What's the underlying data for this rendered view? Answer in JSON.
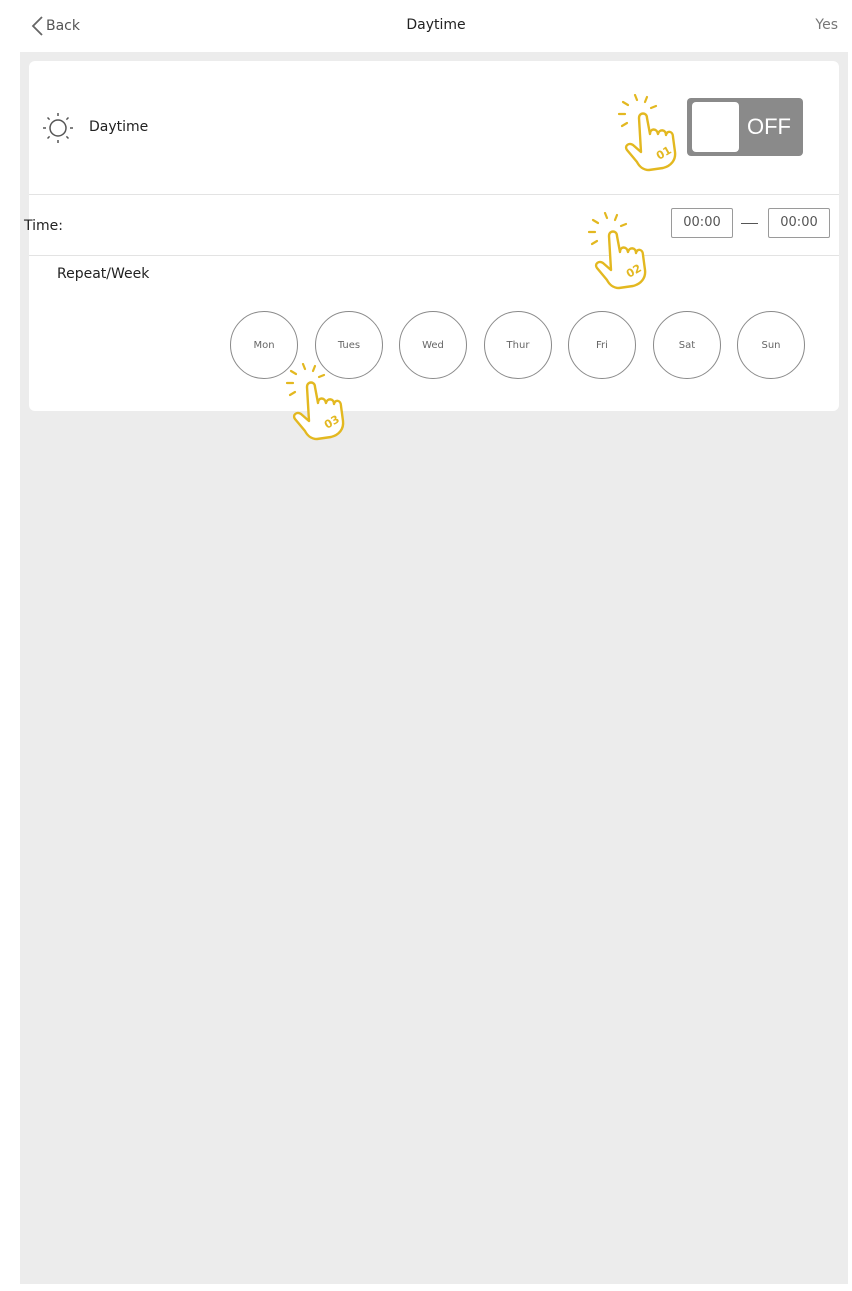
{
  "header": {
    "back_label": "Back",
    "title": "Daytime",
    "confirm_label": "Yes"
  },
  "daytime_row": {
    "label": "Daytime",
    "toggle_state": "OFF"
  },
  "time_row": {
    "label": "Time:",
    "start": "00:00",
    "end": "00:00"
  },
  "repeat": {
    "label": "Repeat/Week",
    "days": [
      "Mon",
      "Tues",
      "Wed",
      "Thur",
      "Fri",
      "Sat",
      "Sun"
    ]
  },
  "hints": [
    {
      "label": "01",
      "target": "daytime-toggle"
    },
    {
      "label": "02",
      "target": "time-range"
    },
    {
      "label": "03",
      "target": "day-mon"
    }
  ],
  "colors": {
    "hint_yellow": "#e3b820",
    "toggle_off": "#8a8a8a",
    "background": "#ececec"
  }
}
